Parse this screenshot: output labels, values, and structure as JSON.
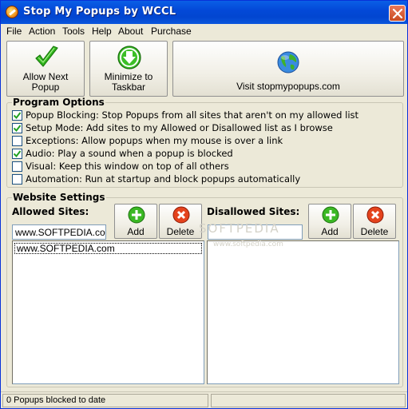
{
  "window": {
    "title": "Stop My Popups by WCCL"
  },
  "menu": [
    "File",
    "Action",
    "Tools",
    "Help",
    "About",
    "Purchase"
  ],
  "toolbar": {
    "allow_next_popup": "Allow Next\nPopup",
    "minimize_to_taskbar": "Minimize to\nTaskbar",
    "visit_site": "Visit stopmypopups.com"
  },
  "program_options": {
    "title": "Program Options",
    "items": [
      {
        "label": "Popup Blocking: Stop Popups from all sites that aren't on my allowed list",
        "checked": true
      },
      {
        "label": "Setup Mode: Add sites to my Allowed or Disallowed list as I browse",
        "checked": true
      },
      {
        "label": "Exceptions: Allow popups when my mouse is over a link",
        "checked": false
      },
      {
        "label": "Audio: Play a sound when a popup is blocked",
        "checked": true
      },
      {
        "label": "Visual: Keep this window on top of all others",
        "checked": false
      },
      {
        "label": "Automation: Run at startup and block popups automatically",
        "checked": false
      }
    ]
  },
  "website_settings": {
    "title": "Website Settings",
    "allowed": {
      "label": "Allowed Sites:",
      "input_value": "www.SOFTPEDIA.co",
      "add_label": "Add",
      "delete_label": "Delete",
      "sites": [
        "www.SOFTPEDIA.com"
      ]
    },
    "disallowed": {
      "label": "Disallowed Sites:",
      "input_value": "",
      "add_label": "Add",
      "delete_label": "Delete",
      "sites": []
    }
  },
  "status": {
    "text": "0 Popups blocked to date",
    "pane2": ""
  },
  "watermark": {
    "main": "SOFTPEDIA",
    "sub": "www.softpedia.com"
  }
}
